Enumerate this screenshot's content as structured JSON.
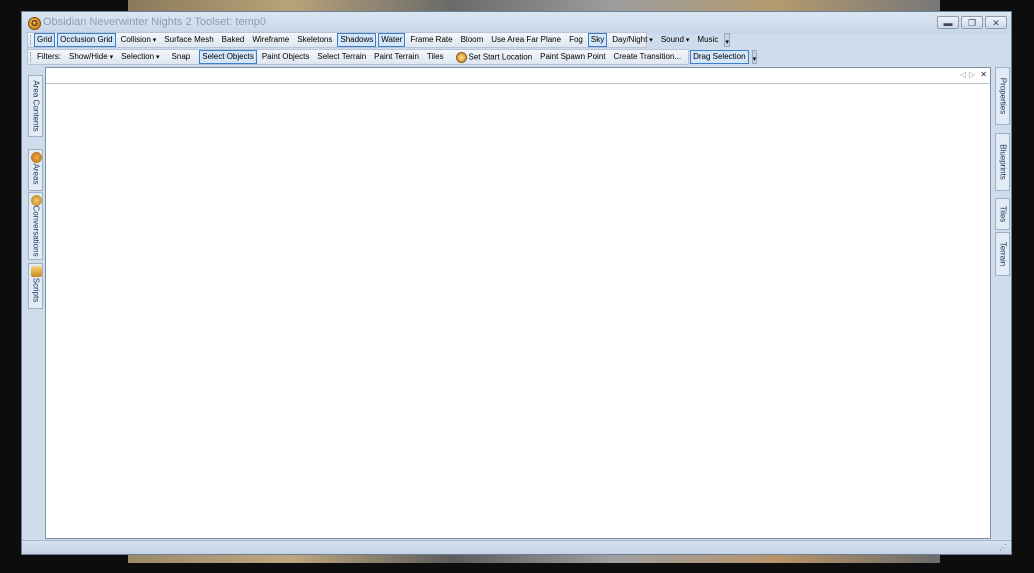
{
  "window": {
    "title": "Obsidian Neverwinter Nights 2 Toolset: temp0",
    "app_icon": "nwn2-toolset-icon",
    "controls": [
      "minimize-icon",
      "restore-icon",
      "close-icon"
    ]
  },
  "toolbar_view": {
    "items": [
      {
        "label": "Grid",
        "active": true
      },
      {
        "label": "Occlusion Grid",
        "active": true
      },
      {
        "label": "Collision",
        "dropdown": true
      },
      {
        "label": "Surface Mesh"
      },
      {
        "label": "Baked"
      },
      {
        "label": "Wireframe"
      },
      {
        "label": "Skeletons"
      },
      {
        "label": "Shadows",
        "active": true
      },
      {
        "label": "Water",
        "active": true
      },
      {
        "label": "Frame Rate"
      },
      {
        "label": "Bloom"
      },
      {
        "label": "Use Area Far Plane"
      },
      {
        "label": "Fog"
      },
      {
        "label": "Sky",
        "active": true
      },
      {
        "label": "Day/Night",
        "dropdown": true
      },
      {
        "label": "Sound",
        "dropdown": true
      },
      {
        "label": "Music"
      }
    ]
  },
  "toolbar_edit": {
    "filters_label": "Filters:",
    "show_hide": "Show/Hide",
    "selection": "Selection",
    "snap": "Snap",
    "select_objects": "Select Objects",
    "paint_objects": "Paint Objects",
    "select_terrain": "Select Terrain",
    "paint_terrain": "Paint Terrain",
    "tiles": "Tiles",
    "set_start_location": "Set Start Location",
    "paint_spawn_point": "Paint Spawn Point",
    "create_transition": "Create Transition...",
    "drag_selection": "Drag Selection"
  },
  "left_panel_tabs": [
    "Area Contents",
    "Areas",
    "Conversations",
    "Scripts"
  ],
  "right_panel_tabs": [
    "Properties",
    "Blueprints",
    "Tiles",
    "Terrain"
  ],
  "colors": {
    "chrome": "#cfdceb",
    "active_border": "#3f7fc9",
    "title_text": "#8e9cae"
  }
}
